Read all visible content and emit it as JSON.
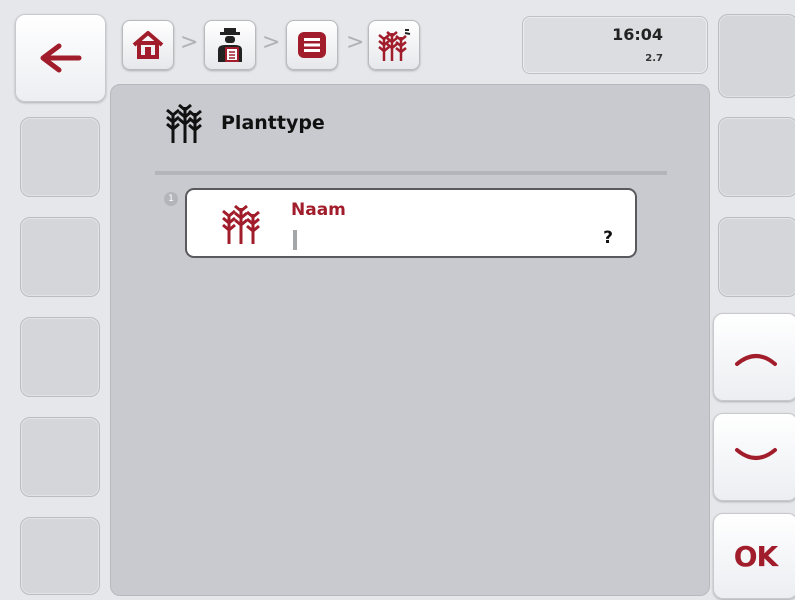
{
  "header": {
    "breadcrumb_separators": [
      ">",
      ">",
      ">"
    ],
    "breadcrumb_icons": [
      "home-icon",
      "farmer-icon",
      "list-menu-icon",
      "crop-type-icon"
    ]
  },
  "status": {
    "time": "16:04",
    "version": "2.7"
  },
  "main": {
    "title": "Planttype",
    "fields": [
      {
        "index": "1",
        "label": "Naam",
        "value": "",
        "help": "?"
      }
    ]
  },
  "softkeys": {
    "back_icon": "arrow-left-icon",
    "up_icon": "chevron-up-icon",
    "down_icon": "chevron-down-icon",
    "ok_label": "OK"
  },
  "colors": {
    "accent_red": "#a11d2b",
    "panel": "#c9cacf",
    "background": "#e6e7eb"
  }
}
